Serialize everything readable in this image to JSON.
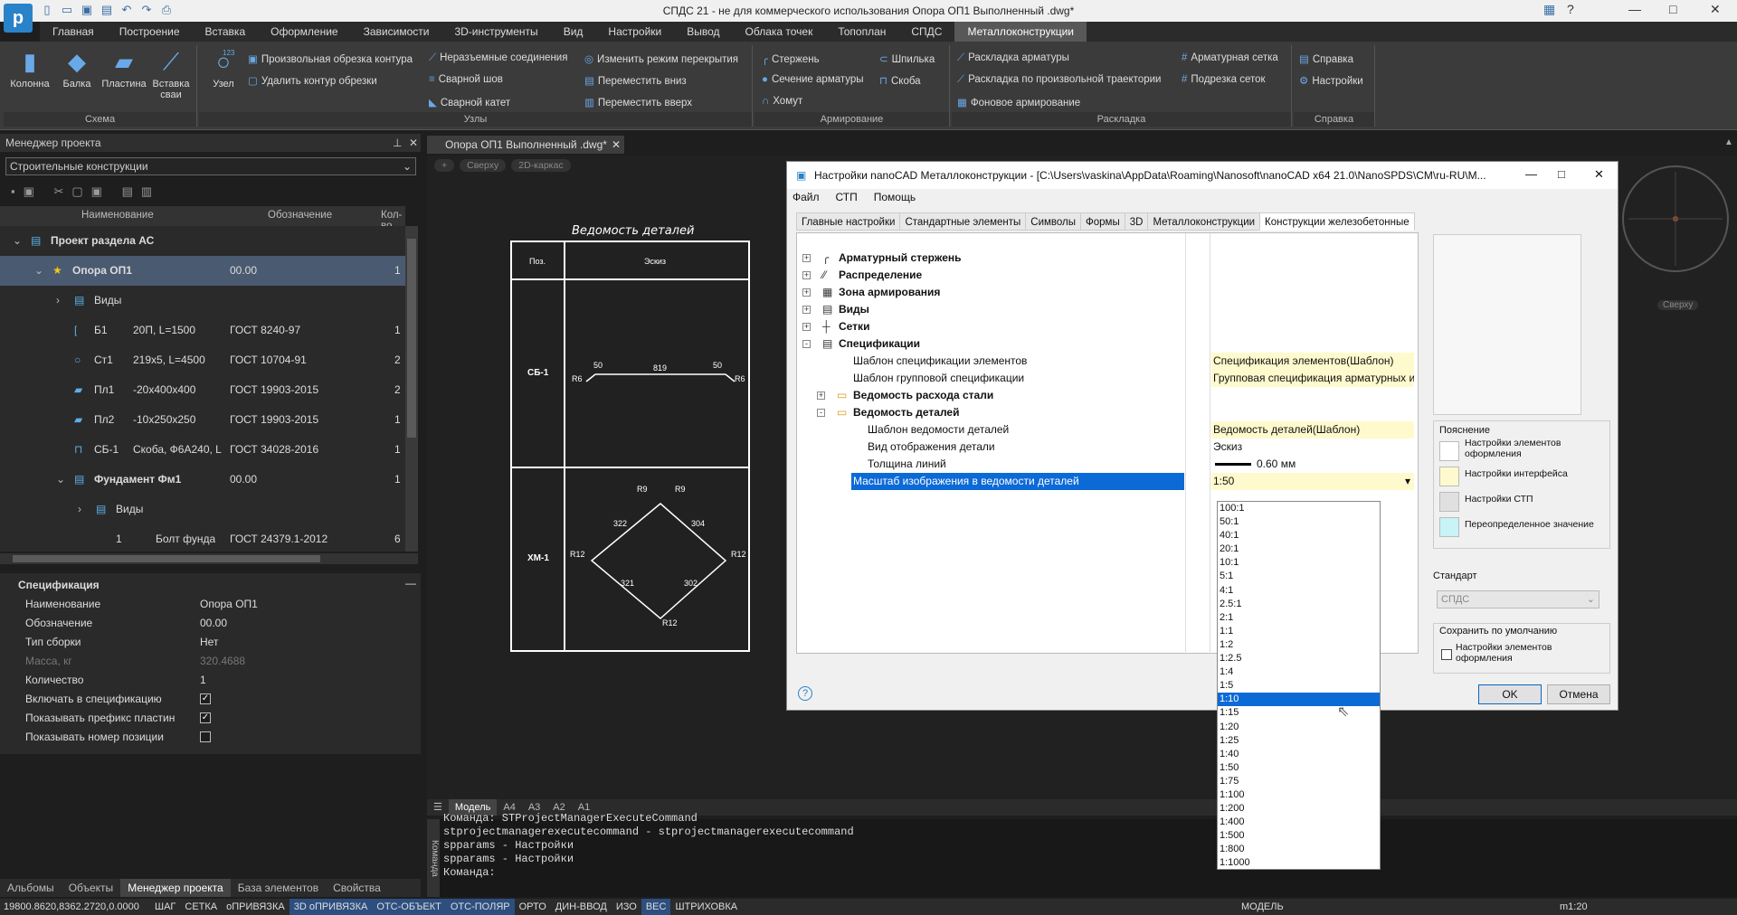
{
  "window": {
    "title": "СПДС 21 - не для коммерческого использования Опора ОП1 Выполненный .dwg*"
  },
  "menu_tabs": [
    "Главная",
    "Построение",
    "Вставка",
    "Оформление",
    "Зависимости",
    "3D-инструменты",
    "Вид",
    "Настройки",
    "Вывод",
    "Облака точек",
    "Топоплан",
    "СПДС",
    "Металлоконструкции"
  ],
  "active_tab": "Металлоконструкции",
  "ribbon": {
    "schema": {
      "label": "Схема",
      "buttons": [
        "Колонна",
        "Балка",
        "Пластина",
        "Вставка сваи"
      ]
    },
    "uzel": {
      "button": "Узел",
      "button_badge": "123",
      "items": [
        "Произвольная обрезка контура",
        "Удалить контур обрезки"
      ]
    },
    "uzly": {
      "label": "Узлы",
      "col1": [
        "Неразъемные соединения",
        "Сварной шов",
        "Сварной катет"
      ],
      "col2": [
        "Изменить режим перекрытия",
        "Переместить вниз",
        "Переместить вверх"
      ]
    },
    "arm": {
      "label": "Армирование",
      "col1": [
        "Стержень",
        "Сечение арматуры",
        "Хомут"
      ],
      "col2": [
        "Шпилька",
        "Скоба"
      ]
    },
    "raskl": {
      "label": "Раскладка",
      "col1": [
        "Раскладка арматуры",
        "Раскладка по произвольной траектории",
        "Фоновое армирование"
      ],
      "col2": [
        "Арматурная сетка",
        "Подрезка сеток"
      ]
    },
    "help": {
      "label": "Справка",
      "items": [
        "Справка",
        "Настройки"
      ]
    }
  },
  "project_manager": {
    "header": "Менеджер проекта",
    "combo": "Строительные конструкции",
    "columns": [
      "Наименование",
      "Обозначение",
      "Кол-во"
    ],
    "rows": [
      {
        "name": "Проект раздела АС",
        "code": "",
        "doc": "",
        "qty": ""
      },
      {
        "name": "Опора ОП1",
        "code": "00.00",
        "doc": "",
        "qty": "1"
      },
      {
        "name": "Виды",
        "code": "",
        "doc": "",
        "qty": ""
      },
      {
        "name": "Б1",
        "code": "20П, L=1500",
        "doc": "ГОСТ 8240-97",
        "qty": "1"
      },
      {
        "name": "Ст1",
        "code": "219x5, L=4500",
        "doc": "ГОСТ 10704-91",
        "qty": "2"
      },
      {
        "name": "Пл1",
        "code": "-20x400x400",
        "doc": "ГОСТ 19903-2015",
        "qty": "2"
      },
      {
        "name": "Пл2",
        "code": "-10x250x250",
        "doc": "ГОСТ 19903-2015",
        "qty": "1"
      },
      {
        "name": "СБ-1",
        "code": "Скоба, Ф6А240, L",
        "doc": "ГОСТ 34028-2016",
        "qty": "1"
      },
      {
        "name": "Фундамент Фм1",
        "code": "00.00",
        "doc": "",
        "qty": "1"
      },
      {
        "name": "Виды",
        "code": "",
        "doc": "",
        "qty": ""
      },
      {
        "name": "1",
        "code": "Болт фунда",
        "doc": "ГОСТ 24379.1-2012",
        "qty": "6"
      }
    ]
  },
  "spec": {
    "header": "Спецификация",
    "rows": [
      {
        "k": "Наименование",
        "v": "Опора ОП1"
      },
      {
        "k": "Обозначение",
        "v": "00.00"
      },
      {
        "k": "Тип сборки",
        "v": "Нет"
      },
      {
        "k": "Масса, кг",
        "v": "320.4688"
      },
      {
        "k": "Количество",
        "v": "1"
      },
      {
        "k": "Включать в спецификацию",
        "v": "✓"
      },
      {
        "k": "Показывать префикс пластин",
        "v": "✓"
      },
      {
        "k": "Показывать номер позиции",
        "v": ""
      }
    ]
  },
  "bottom_tabs": [
    "Альбомы",
    "Объекты",
    "Менеджер проекта",
    "База элементов",
    "Свойства"
  ],
  "doc_tab": "Опора ОП1 Выполненный .dwg*",
  "view_labels": [
    "+",
    "Сверху",
    "2D-каркас"
  ],
  "drawing": {
    "title": "Ведомость деталей",
    "col1": "Поз.",
    "col2": "Эскиз",
    "row1": "СБ-1",
    "row2": "ХМ-1",
    "dims1": [
      "50",
      "819",
      "50",
      "R6",
      "R6"
    ],
    "dims2": [
      "R9",
      "R9",
      "322",
      "304",
      "R12",
      "R12",
      "321",
      "302",
      "R12"
    ]
  },
  "viewcube": "Сверху",
  "layout_tabs": [
    "Модель",
    "А4",
    "А3",
    "А2",
    "А1"
  ],
  "cmd_lines": [
    "Команда: STProjectManagerExecuteCommand",
    "stprojectmanagerexecutecommand - stprojectmanagerexecutecommand",
    "spparams - Настройки",
    "spparams - Настройки",
    "Команда:"
  ],
  "cmd_label": "Команда",
  "status": {
    "coords": "19800.8620,8362.2720,0.0000",
    "buttons": [
      "ШАГ",
      "СЕТКА",
      "оПРИВЯЗКА",
      "3D оПРИВЯЗКА",
      "ОТС-ОБЪЕКТ",
      "ОТС-ПОЛЯР",
      "ОРТО",
      "ДИН-ВВОД",
      "ИЗО",
      "ВЕС",
      "ШТРИХОВКА"
    ],
    "space": "МОДЕЛЬ",
    "scale": "m1:20"
  },
  "dialog": {
    "title": "Настройки nanoCAD Металлоконструкции - [C:\\Users\\vaskina\\AppData\\Roaming\\Nanosoft\\nanoCAD x64 21.0\\NanoSPDS\\CM\\ru-RU\\M...",
    "menu": [
      "Файл",
      "СТП",
      "Помощь"
    ],
    "tabs": [
      "Главные настройки",
      "Стандартные элементы",
      "Символы",
      "Формы",
      "3D",
      "Металлоконструкции",
      "Конструкции железобетонные"
    ],
    "rows": [
      {
        "label": "Арматурный стержень",
        "value": "",
        "bold": true
      },
      {
        "label": "Распределение",
        "value": "",
        "bold": true
      },
      {
        "label": "Зона армирования",
        "value": "",
        "bold": true
      },
      {
        "label": "Виды",
        "value": "",
        "bold": true
      },
      {
        "label": "Сетки",
        "value": "",
        "bold": true
      },
      {
        "label": "Спецификации",
        "value": "",
        "bold": true
      },
      {
        "label": "Шаблон спецификации элементов",
        "value": "Спецификация элементов(Шаблон)",
        "bold": false
      },
      {
        "label": "Шаблон групповой спецификации",
        "value": "Групповая спецификация арматурных и",
        "bold": false
      },
      {
        "label": "Ведомость расхода стали",
        "value": "",
        "bold": true
      },
      {
        "label": "Ведомость деталей",
        "value": "",
        "bold": true
      },
      {
        "label": "Шаблон ведомости деталей",
        "value": "Ведомость деталей(Шаблон)",
        "bold": false
      },
      {
        "label": "Вид отображения детали",
        "value": "Эскиз",
        "bold": false
      },
      {
        "label": "Толщина линий",
        "value": "0.60 мм",
        "bold": false
      },
      {
        "label": "Масштаб изображения в ведомости деталей",
        "value": "1:50",
        "bold": false
      }
    ],
    "legend_title": "Пояснение",
    "legend": [
      {
        "label": "Настройки элементов оформления",
        "color": "#ffffff"
      },
      {
        "label": "Настройки интерфейса",
        "color": "#fffacd"
      },
      {
        "label": "Настройки СТП",
        "color": "#e0e0e0"
      },
      {
        "label": "Переопределенное значение",
        "color": "#c8f3f7"
      }
    ],
    "standard_label": "Стандарт",
    "standard_value": "СПДС",
    "save_label": "Сохранить по умолчанию",
    "save_option": "Настройки элементов оформления",
    "ok": "OK",
    "cancel": "Отмена",
    "help": "?"
  },
  "scale_options": [
    "100:1",
    "50:1",
    "40:1",
    "20:1",
    "10:1",
    "5:1",
    "4:1",
    "2.5:1",
    "2:1",
    "1:1",
    "1:2",
    "1:2.5",
    "1:4",
    "1:5",
    "1:10",
    "1:15",
    "1:20",
    "1:25",
    "1:40",
    "1:50",
    "1:75",
    "1:100",
    "1:200",
    "1:400",
    "1:500",
    "1:800",
    "1:1000"
  ],
  "selected_scale": "1:10"
}
